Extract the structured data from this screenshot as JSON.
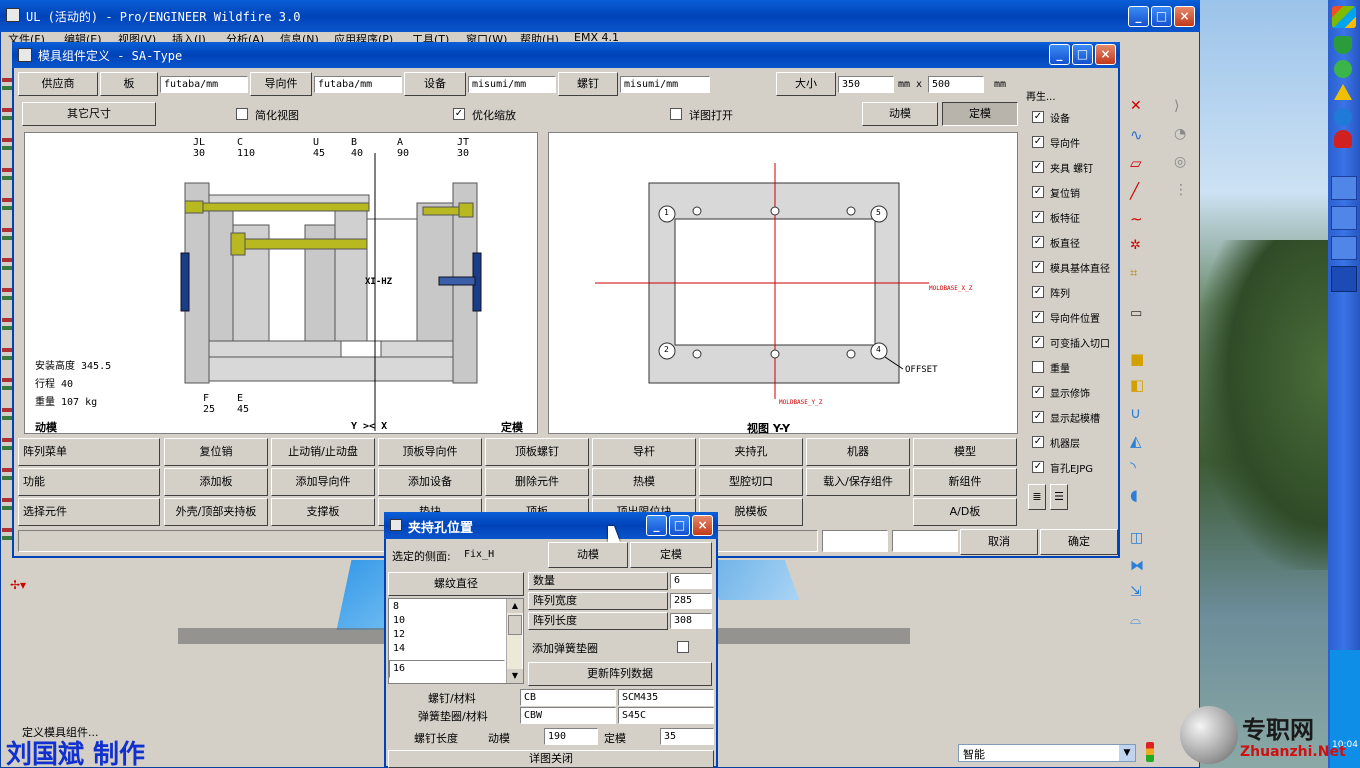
{
  "proe_window": {
    "title": "UL (活动的) - Pro/ENGINEER Wildfire 3.0",
    "menu": [
      "文件(F)",
      "编辑(E)",
      "视图(V)",
      "插入(I)",
      "分析(A)",
      "信息(N)",
      "应用程序(P)",
      "工具(T)",
      "窗口(W)",
      "帮助(H)",
      "EMX 4.1"
    ],
    "status_text": "定义模具组件...",
    "filter_value": "智能"
  },
  "watermark": {
    "author": "刘国斌 制作",
    "site_cn": "专职网",
    "site_en": "Zhuanzhi.Net"
  },
  "tray_time": "10:04",
  "main_dialog": {
    "title": "模具组件定义 - SA-Type",
    "row1": {
      "supplier_btn": "供应商",
      "plate_btn": "板",
      "plate_value": "futaba/mm",
      "guide_btn": "导向件",
      "guide_value": "futaba/mm",
      "equip_btn": "设备",
      "equip_value": "misumi/mm",
      "screw_btn": "螺钉",
      "screw_value": "misumi/mm",
      "size_btn": "大小",
      "size_x": "350",
      "size_sep": "mm x",
      "size_y": "500",
      "size_unit": "mm"
    },
    "row2": {
      "other_size_btn": "其它尺寸",
      "simplify_label": "简化视图",
      "optimize_label": "优化缩放",
      "detail_label": "详图打开",
      "moving_btn": "动模",
      "fixed_btn": "定模"
    },
    "left_view": {
      "top_labels": [
        {
          "name": "JL",
          "val": "30"
        },
        {
          "name": "C",
          "val": "110"
        },
        {
          "name": "U",
          "val": "45"
        },
        {
          "name": "B",
          "val": "40"
        },
        {
          "name": "A",
          "val": "90"
        },
        {
          "name": "JT",
          "val": "30"
        }
      ],
      "bottom_labels": [
        {
          "name": "F",
          "val": "25"
        },
        {
          "name": "E",
          "val": "45"
        }
      ],
      "install_height": "安装高度 345.5",
      "stroke": "行程 40",
      "weight": "重量 107 kg",
      "moving_label": "动模",
      "axis_label": "Y >< X",
      "fixed_label": "定模",
      "csys_label": "XI-HZ"
    },
    "right_view": {
      "offset_label": "OFFSET",
      "csys_x_label": "MOLDBASE_X_Z",
      "csys_y_label": "MOLDBASE_Y_Z",
      "view_label": "视图 Y-Y",
      "corner_nums": [
        "1",
        "5",
        "2",
        "4"
      ]
    },
    "regen": {
      "title": "再生...",
      "items": [
        {
          "label": "设备",
          "checked": true
        },
        {
          "label": "导向件",
          "checked": true
        },
        {
          "label": "夹具 螺钉",
          "checked": true
        },
        {
          "label": "复位销",
          "checked": true
        },
        {
          "label": "板特征",
          "checked": true
        },
        {
          "label": "板直径",
          "checked": true
        },
        {
          "label": "模具基体直径",
          "checked": true
        },
        {
          "label": "阵列",
          "checked": true
        },
        {
          "label": "导向件位置",
          "checked": true
        },
        {
          "label": "可变插入切口",
          "checked": true
        },
        {
          "label": "重量",
          "checked": false
        },
        {
          "label": "显示修饰",
          "checked": true
        },
        {
          "label": "显示起模槽",
          "checked": true
        },
        {
          "label": "机器层",
          "checked": true
        },
        {
          "label": "盲孔EJPG",
          "checked": true
        }
      ]
    },
    "grid": {
      "row_labels": [
        "阵列菜单",
        "功能",
        "选择元件"
      ],
      "row1": [
        "复位销",
        "止动销/止动盘",
        "顶板导向件",
        "顶板螺钉",
        "导杆",
        "夹持孔",
        "机器",
        "模型"
      ],
      "row2": [
        "添加板",
        "添加导向件",
        "添加设备",
        "删除元件",
        "热模",
        "型腔切口",
        "载入/保存组件",
        "新组件"
      ],
      "row3": [
        "外壳/顶部夹持板",
        "支撑板",
        "垫块",
        "顶板",
        "顶出限位块",
        "脱模板",
        "A/D板"
      ]
    },
    "cancel_btn": "取消",
    "ok_btn": "确定"
  },
  "clamp_dialog": {
    "title": "夹持孔位置",
    "side_label": "选定的侧面:",
    "side_value": "Fix_H",
    "moving_btn": "动模",
    "fixed_btn": "定模",
    "thread_dia_btn": "螺纹直径",
    "dia_list": [
      "8",
      "10",
      "12",
      "14"
    ],
    "dia_selected": "16",
    "qty_label": "数量",
    "qty_value": "6",
    "width_label": "阵列宽度",
    "width_value": "285",
    "length_label": "阵列长度",
    "length_value": "308",
    "washer_label": "添加弹簧垫圈",
    "update_btn": "更新阵列数据",
    "screw_mat_label": "螺钉/材料",
    "screw_code": "CB",
    "screw_mat": "SCM435",
    "washer_mat_label": "弹簧垫圈/材料",
    "washer_code": "CBW",
    "washer_mat": "S45C",
    "screw_len_label": "螺钉长度",
    "len_moving_label": "动模",
    "len_moving_value": "190",
    "len_fixed_label": "定模",
    "len_fixed_value": "35",
    "close_btn": "详图关闭"
  },
  "colors": {
    "xp_blue": "#0a55cc",
    "dialog_gray": "#d4d0c8",
    "plate_gray": "#c8c8c8",
    "pin_yellow": "#b8b820",
    "clamp_blue": "#1a3d8a",
    "csys_red": "#cc0000"
  }
}
